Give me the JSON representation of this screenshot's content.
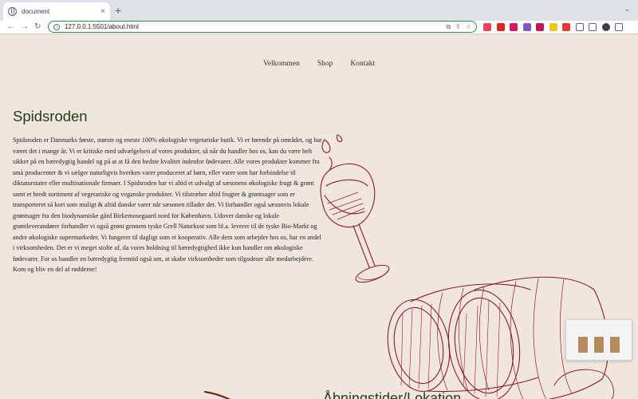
{
  "browser": {
    "tab_title": "document",
    "tab_close": "×",
    "new_tab": "+",
    "url": "127.0.0.1:5501/about.html",
    "window_controls": "⌄",
    "nav": {
      "back": "←",
      "forward": "→",
      "reload": "↻"
    },
    "extensions": [
      {
        "name": "pocket-icon",
        "color": "#ef4056"
      },
      {
        "name": "counter-icon",
        "color": "#e02424"
      },
      {
        "name": "tp-icon",
        "color": "#d81b60"
      },
      {
        "name": "circle-ext-icon",
        "color": "#7e57c2"
      },
      {
        "name": "color-ext-icon",
        "color": "#c2185b"
      },
      {
        "name": "imdb-icon",
        "color": "#f5c518"
      },
      {
        "name": "grid-ext-icon",
        "color": "#e53935"
      },
      {
        "name": "puzzle-icon",
        "color": "#5f6368"
      },
      {
        "name": "sidebar-icon",
        "color": "#5f6368"
      },
      {
        "name": "profile-avatar",
        "color": "#3c4043"
      },
      {
        "name": "menu-icon",
        "color": "#5f6368"
      }
    ]
  },
  "site": {
    "nav": [
      "Velkommen",
      "Shop",
      "Kontakt"
    ],
    "heading": "Spidsroden",
    "about": "Spidsroden er Danmarks første, største og eneste 100% økologiske vegetariske butik. Vi er førende på området, og har været det i mange år. Vi er kritiske med udvælgelsen af vores produkter, så når du handler hos os, kan du være helt sikker på en bæredygtig handel og på at at få den bedste kvalitet indenfor fødevarer. Alle vores produkter kommer fra små producenter & vi sælger naturligvis hverken varer produceret af børn, eller varer som har forbindelse til diktaturstater eller multinationale firmaer. I Spidsroden har vi altid et udvalgt af sæsonens økologiske frugt & grønt samt et bredt sortiment af vegetariske og veganske produkter. Vi tilstræber altid frugter & grøntsager som er transporteret så kort som muligt & altid danske varer når sæsonen tillader det. Vi forhandler også sæsonvis lokale grøntsager fra den biodynamiske gård Birkemosegaard nord for København. Udover danske og lokale grøntleverandører forhandler vi også grønt gennem tyske Grell Naturkost som bl.a. leverer til de tyske Bio-Markt og andre økologiske supermarkeder. Vi fungerer til dagligt som et kooperativ. Alle dem som arbejder hos os, har en andel i virksomheden. Det er vi meget stolte af, da vores holdning til bæredygtighed ikke kun handler om økologiske fødevarer. For os handler en bæredygtig fremtid også om, at skabe virksomheder som tilgodeser alle medarbejdere. Kom og bliv en del af rødderne!",
    "bottom_heading": "Åbningstider/Lokation"
  },
  "colors": {
    "page_bg": "#f1e6df",
    "heading": "#1f3e17",
    "illustration": "#8b1c2a"
  }
}
